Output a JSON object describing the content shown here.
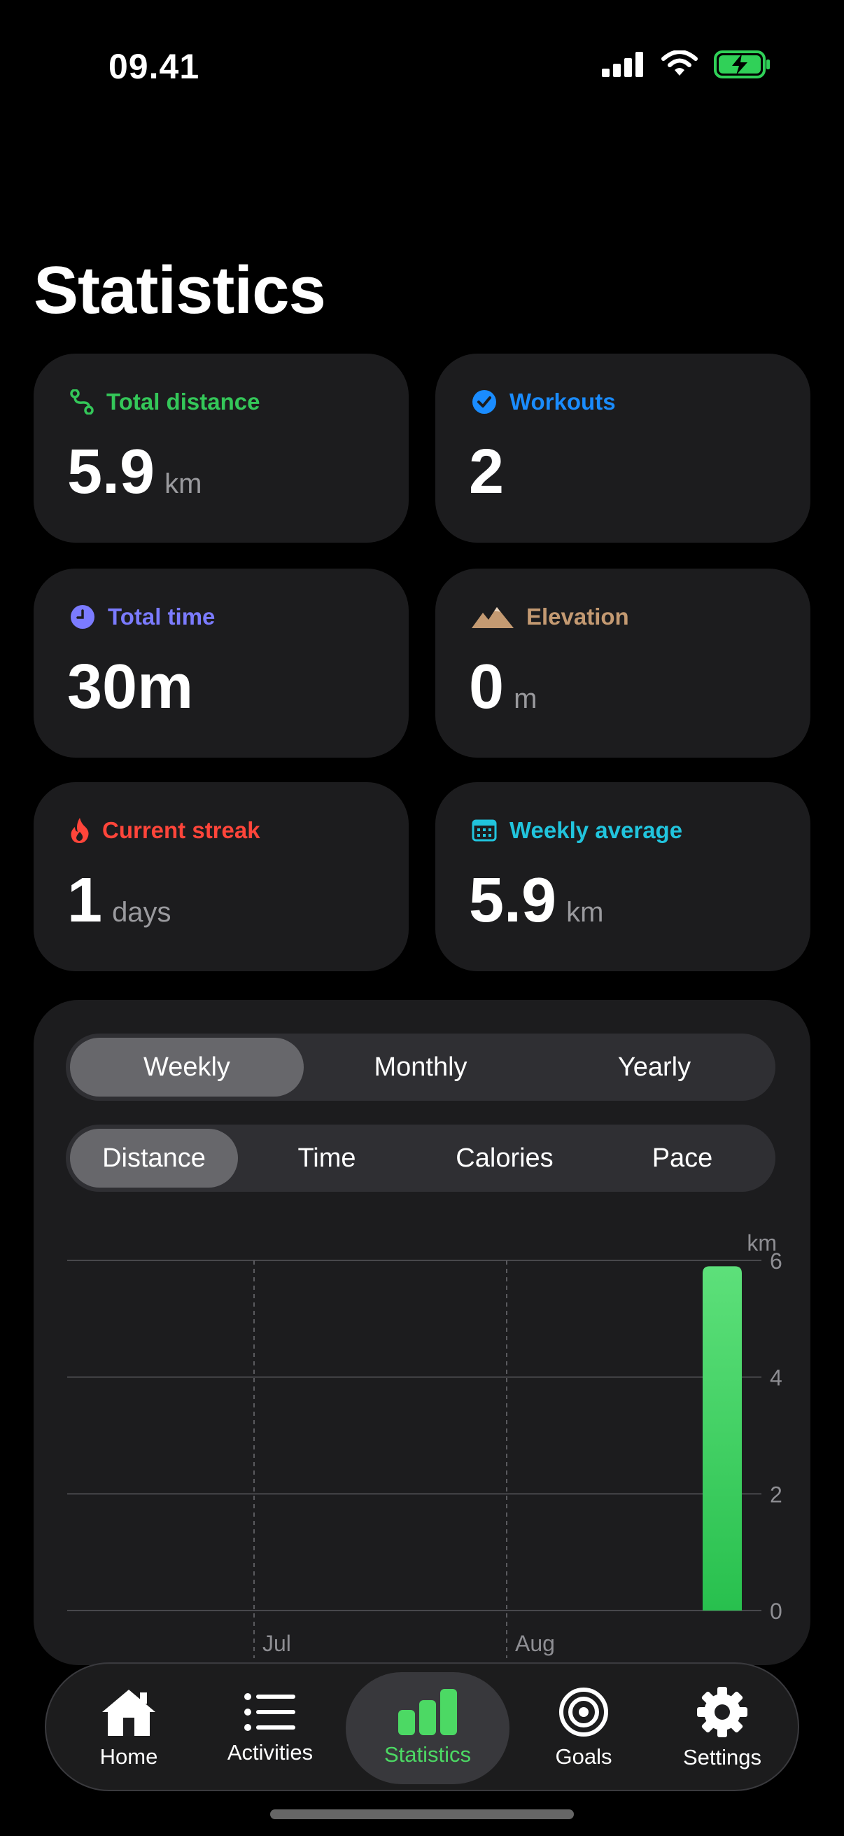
{
  "status_bar": {
    "time": "09.41"
  },
  "page": {
    "title": "Statistics"
  },
  "cards": {
    "total_distance": {
      "label": "Total distance",
      "value": "5.9",
      "unit": "km",
      "color": "#34c759"
    },
    "workouts": {
      "label": "Workouts",
      "value": "2",
      "unit": "",
      "color": "#1a8cff"
    },
    "total_time": {
      "label": "Total time",
      "value": "30m",
      "unit": "",
      "color": "#7b7bff"
    },
    "elevation": {
      "label": "Elevation",
      "value": "0",
      "unit": "m",
      "color": "#c49a72"
    },
    "current_streak": {
      "label": "Current streak",
      "value": "1",
      "unit": "days",
      "color": "#ff453a"
    },
    "weekly_average": {
      "label": "Weekly average",
      "value": "5.9",
      "unit": "km",
      "color": "#21c4dd"
    }
  },
  "period_tabs": [
    "Weekly",
    "Monthly",
    "Yearly"
  ],
  "metric_tabs": [
    "Distance",
    "Time",
    "Calories",
    "Pace"
  ],
  "chart_data": {
    "type": "bar",
    "ylabel": "km",
    "ylim": [
      0,
      6
    ],
    "yticks": [
      "0",
      "2",
      "4",
      "6"
    ],
    "x_labels": [
      "Jul",
      "Aug"
    ],
    "values": [
      5.9
    ],
    "bar_color": "#30d158",
    "grid": true
  },
  "tab_bar": {
    "items": [
      {
        "label": "Home",
        "icon": "house-icon"
      },
      {
        "label": "Activities",
        "icon": "list-icon"
      },
      {
        "label": "Statistics",
        "icon": "bar-chart-icon"
      },
      {
        "label": "Goals",
        "icon": "target-icon"
      },
      {
        "label": "Settings",
        "icon": "gear-icon"
      }
    ],
    "active": "Statistics",
    "accent": "#4cd964"
  }
}
